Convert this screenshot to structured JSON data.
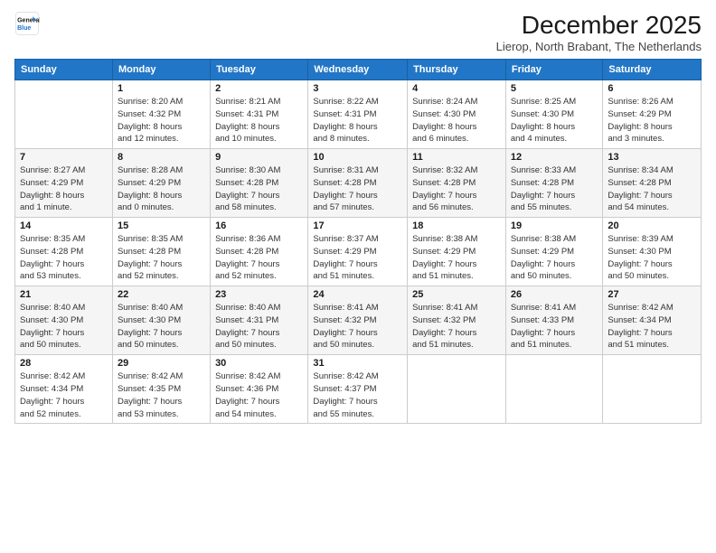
{
  "header": {
    "logo_line1": "General",
    "logo_line2": "Blue",
    "month": "December 2025",
    "location": "Lierop, North Brabant, The Netherlands"
  },
  "weekdays": [
    "Sunday",
    "Monday",
    "Tuesday",
    "Wednesday",
    "Thursday",
    "Friday",
    "Saturday"
  ],
  "weeks": [
    [
      {
        "day": "",
        "info": ""
      },
      {
        "day": "1",
        "info": "Sunrise: 8:20 AM\nSunset: 4:32 PM\nDaylight: 8 hours\nand 12 minutes."
      },
      {
        "day": "2",
        "info": "Sunrise: 8:21 AM\nSunset: 4:31 PM\nDaylight: 8 hours\nand 10 minutes."
      },
      {
        "day": "3",
        "info": "Sunrise: 8:22 AM\nSunset: 4:31 PM\nDaylight: 8 hours\nand 8 minutes."
      },
      {
        "day": "4",
        "info": "Sunrise: 8:24 AM\nSunset: 4:30 PM\nDaylight: 8 hours\nand 6 minutes."
      },
      {
        "day": "5",
        "info": "Sunrise: 8:25 AM\nSunset: 4:30 PM\nDaylight: 8 hours\nand 4 minutes."
      },
      {
        "day": "6",
        "info": "Sunrise: 8:26 AM\nSunset: 4:29 PM\nDaylight: 8 hours\nand 3 minutes."
      }
    ],
    [
      {
        "day": "7",
        "info": "Sunrise: 8:27 AM\nSunset: 4:29 PM\nDaylight: 8 hours\nand 1 minute."
      },
      {
        "day": "8",
        "info": "Sunrise: 8:28 AM\nSunset: 4:29 PM\nDaylight: 8 hours\nand 0 minutes."
      },
      {
        "day": "9",
        "info": "Sunrise: 8:30 AM\nSunset: 4:28 PM\nDaylight: 7 hours\nand 58 minutes."
      },
      {
        "day": "10",
        "info": "Sunrise: 8:31 AM\nSunset: 4:28 PM\nDaylight: 7 hours\nand 57 minutes."
      },
      {
        "day": "11",
        "info": "Sunrise: 8:32 AM\nSunset: 4:28 PM\nDaylight: 7 hours\nand 56 minutes."
      },
      {
        "day": "12",
        "info": "Sunrise: 8:33 AM\nSunset: 4:28 PM\nDaylight: 7 hours\nand 55 minutes."
      },
      {
        "day": "13",
        "info": "Sunrise: 8:34 AM\nSunset: 4:28 PM\nDaylight: 7 hours\nand 54 minutes."
      }
    ],
    [
      {
        "day": "14",
        "info": "Sunrise: 8:35 AM\nSunset: 4:28 PM\nDaylight: 7 hours\nand 53 minutes."
      },
      {
        "day": "15",
        "info": "Sunrise: 8:35 AM\nSunset: 4:28 PM\nDaylight: 7 hours\nand 52 minutes."
      },
      {
        "day": "16",
        "info": "Sunrise: 8:36 AM\nSunset: 4:28 PM\nDaylight: 7 hours\nand 52 minutes."
      },
      {
        "day": "17",
        "info": "Sunrise: 8:37 AM\nSunset: 4:29 PM\nDaylight: 7 hours\nand 51 minutes."
      },
      {
        "day": "18",
        "info": "Sunrise: 8:38 AM\nSunset: 4:29 PM\nDaylight: 7 hours\nand 51 minutes."
      },
      {
        "day": "19",
        "info": "Sunrise: 8:38 AM\nSunset: 4:29 PM\nDaylight: 7 hours\nand 50 minutes."
      },
      {
        "day": "20",
        "info": "Sunrise: 8:39 AM\nSunset: 4:30 PM\nDaylight: 7 hours\nand 50 minutes."
      }
    ],
    [
      {
        "day": "21",
        "info": "Sunrise: 8:40 AM\nSunset: 4:30 PM\nDaylight: 7 hours\nand 50 minutes."
      },
      {
        "day": "22",
        "info": "Sunrise: 8:40 AM\nSunset: 4:30 PM\nDaylight: 7 hours\nand 50 minutes."
      },
      {
        "day": "23",
        "info": "Sunrise: 8:40 AM\nSunset: 4:31 PM\nDaylight: 7 hours\nand 50 minutes."
      },
      {
        "day": "24",
        "info": "Sunrise: 8:41 AM\nSunset: 4:32 PM\nDaylight: 7 hours\nand 50 minutes."
      },
      {
        "day": "25",
        "info": "Sunrise: 8:41 AM\nSunset: 4:32 PM\nDaylight: 7 hours\nand 51 minutes."
      },
      {
        "day": "26",
        "info": "Sunrise: 8:41 AM\nSunset: 4:33 PM\nDaylight: 7 hours\nand 51 minutes."
      },
      {
        "day": "27",
        "info": "Sunrise: 8:42 AM\nSunset: 4:34 PM\nDaylight: 7 hours\nand 51 minutes."
      }
    ],
    [
      {
        "day": "28",
        "info": "Sunrise: 8:42 AM\nSunset: 4:34 PM\nDaylight: 7 hours\nand 52 minutes."
      },
      {
        "day": "29",
        "info": "Sunrise: 8:42 AM\nSunset: 4:35 PM\nDaylight: 7 hours\nand 53 minutes."
      },
      {
        "day": "30",
        "info": "Sunrise: 8:42 AM\nSunset: 4:36 PM\nDaylight: 7 hours\nand 54 minutes."
      },
      {
        "day": "31",
        "info": "Sunrise: 8:42 AM\nSunset: 4:37 PM\nDaylight: 7 hours\nand 55 minutes."
      },
      {
        "day": "",
        "info": ""
      },
      {
        "day": "",
        "info": ""
      },
      {
        "day": "",
        "info": ""
      }
    ]
  ]
}
